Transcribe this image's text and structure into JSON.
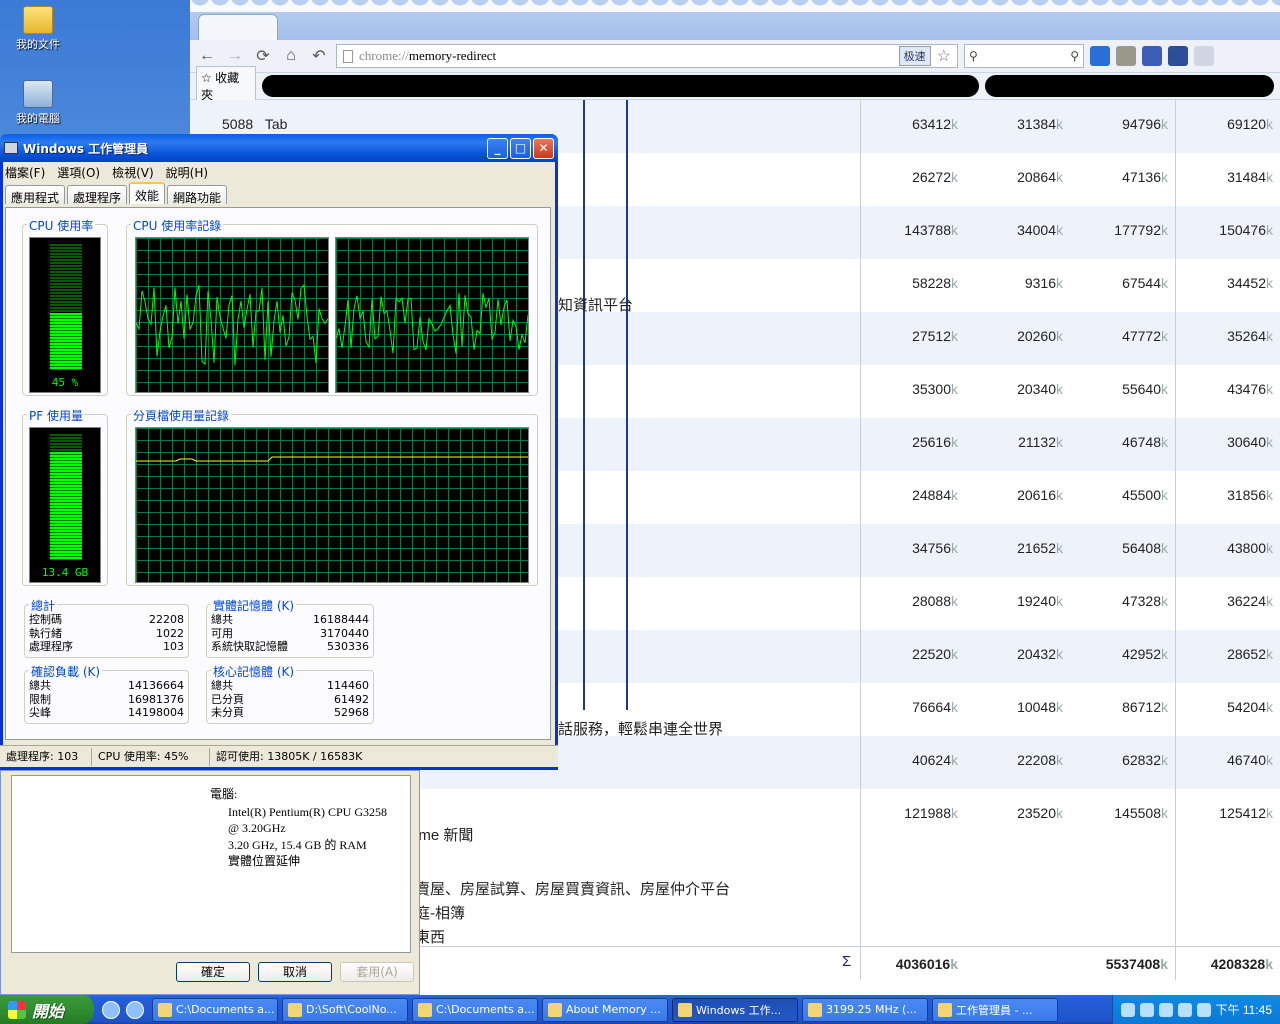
{
  "desktop": {
    "icons": [
      {
        "label": "我的文件",
        "icon": "folder-icon"
      },
      {
        "label": "我的電腦",
        "icon": "computer-icon"
      }
    ]
  },
  "chrome": {
    "url_scheme": "chrome://",
    "url_path": "memory-redirect",
    "speed_badge": "极速",
    "bookmarks_label": "收藏夾",
    "first_process_id": "5088",
    "first_process_label": "Tab",
    "k_unit": "k",
    "rows": [
      [
        "63412",
        "31384",
        "94796",
        "69120"
      ],
      [
        "26272",
        "20864",
        "47136",
        "31484"
      ],
      [
        "143788",
        "34004",
        "177792",
        "150476"
      ],
      [
        "58228",
        "9316",
        "67544",
        "34452"
      ],
      [
        "27512",
        "20260",
        "47772",
        "35264"
      ],
      [
        "35300",
        "20340",
        "55640",
        "43476"
      ],
      [
        "25616",
        "21132",
        "46748",
        "30640"
      ],
      [
        "24884",
        "20616",
        "45500",
        "31856"
      ],
      [
        "34756",
        "21652",
        "56408",
        "43800"
      ],
      [
        "28088",
        "19240",
        "47328",
        "36224"
      ],
      [
        "22520",
        "20432",
        "42952",
        "28652"
      ],
      [
        "76664",
        "10048",
        "86712",
        "54204"
      ],
      [
        "40624",
        "22208",
        "62832",
        "46740"
      ],
      [
        "121988",
        "23520",
        "145508",
        "125412"
      ]
    ],
    "fragments": {
      "f1": "知資訊平台",
      "f2": "話服務，輕鬆串連全世界",
      "f3": "ome 新聞",
      "f4": "賣屋、房屋試算、房屋買賣資訊、房屋仲介平台",
      "f5": "庭-相簿",
      "f6": "東西"
    },
    "sum_symbol": "Σ",
    "sum": {
      "c1": "4036016",
      "c3": "5537408",
      "c4": "4208328"
    }
  },
  "props_dialog": {
    "computer_label": "電腦:",
    "cpu_line1": "Intel(R) Pentium(R) CPU G3258",
    "cpu_line2": "@ 3.20GHz",
    "cpu_line3": "3.20 GHz, 15.4 GB 的 RAM",
    "cpu_line4": "實體位置延伸",
    "ok": "確定",
    "cancel": "取消",
    "apply": "套用(A)"
  },
  "taskmgr": {
    "title": "Windows 工作管理員",
    "menu": [
      "檔案(F)",
      "選項(O)",
      "檢視(V)",
      "說明(H)"
    ],
    "tabs": [
      "應用程式",
      "處理程序",
      "效能",
      "網路功能"
    ],
    "active_tab_index": 2,
    "cpu_usage_title": "CPU 使用率",
    "cpu_usage_value": "45 %",
    "cpu_usage_fraction": 0.45,
    "cpu_history_title": "CPU 使用率記錄",
    "pf_usage_title": "PF 使用量",
    "pf_usage_value": "13.4 GB",
    "pf_usage_fraction": 0.86,
    "pf_history_title": "分頁檔使用量記錄",
    "totals": {
      "title": "總計",
      "rows": [
        [
          "控制碼",
          "22208"
        ],
        [
          "執行緒",
          "1022"
        ],
        [
          "處理程序",
          "103"
        ]
      ]
    },
    "physical": {
      "title": "實體記憶體 (K)",
      "rows": [
        [
          "總共",
          "16188444"
        ],
        [
          "可用",
          "3170440"
        ],
        [
          "系統快取記憶體",
          "530336"
        ]
      ]
    },
    "commit": {
      "title": "確認負載 (K)",
      "rows": [
        [
          "總共",
          "14136664"
        ],
        [
          "限制",
          "16981376"
        ],
        [
          "尖峰",
          "14198004"
        ]
      ]
    },
    "kernel": {
      "title": "核心記憶體 (K)",
      "rows": [
        [
          "總共",
          "114460"
        ],
        [
          "已分頁",
          "61492"
        ],
        [
          "未分頁",
          "52968"
        ]
      ]
    },
    "status": {
      "processes": "處理程序: 103",
      "cpu": "CPU 使用率: 45%",
      "commit": "認可使用: 13805K / 16583K"
    }
  },
  "taskbar": {
    "start": "開始",
    "buttons": [
      {
        "label": "C:\\Documents a...",
        "active": false
      },
      {
        "label": "D:\\Soft\\CoolNo...",
        "active": false
      },
      {
        "label": "C:\\Documents a...",
        "active": false
      },
      {
        "label": "About Memory ...",
        "active": false
      },
      {
        "label": "Windows 工作...",
        "active": true
      },
      {
        "label": "3199.25 MHz (...",
        "active": false
      },
      {
        "label": "工作管理員 - ...",
        "active": false
      }
    ],
    "clock": "下午 11:45"
  }
}
